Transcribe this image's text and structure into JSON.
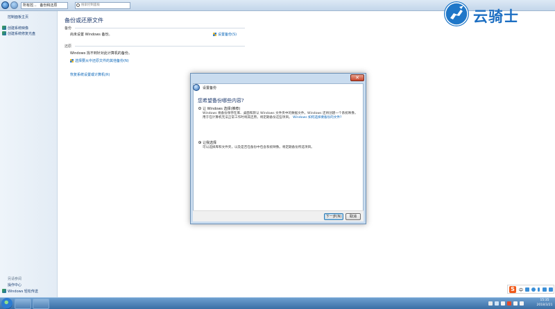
{
  "addressbar": {
    "crumbs": [
      "所有控...",
      "备份和还原"
    ],
    "search_placeholder": "搜索控制面板"
  },
  "leftpane": {
    "home": "控制面板主页",
    "links": [
      "创建系统映像",
      "创建系统修复光盘"
    ],
    "see_also": "另请参阅",
    "action_center": "操作中心",
    "easy_transfer": "Windows 轻松传送"
  },
  "main": {
    "title": "备份或还原文件",
    "backup_label": "备份",
    "backup_status": "尚未设置 Windows 备份。",
    "setup_backup_link": "设置备份(S)",
    "restore_label": "还原",
    "restore_status": "Windows 找不到针对此计算机的备份。",
    "select_backup_link": "选择要从中还原文件的其他备份(N)",
    "recover_link": "恢复系统设置或计算机(R)"
  },
  "dialog": {
    "window_title": "设置备份",
    "close_glyph": "✕",
    "heading": "您希望备份哪些内容?",
    "option1_title": "让 Windows 选择(推荐)",
    "option1_desc": "Windows 将备份保存在库、桌面和默认 Windows 文件夹中的数据文件。Windows 还将创建一个系统映像，用于在计算机无法正常工作时将其还原。将定期备份这些项目。",
    "option1_link": "Windows 如何选择要备份的文件?",
    "option2_title": "让我选择",
    "option2_desc": "可以选择库和文件夹，以及是否在备份中包含系统映像。将定期备份所选项目。",
    "next_button": "下一步(N)",
    "cancel_button": "取消"
  },
  "watermark": {
    "text": "云骑士"
  },
  "taskbar": {
    "clock_time": "15:35",
    "clock_date": "2018/3/21",
    "ime_letter": "S",
    "ime_mode": "中"
  },
  "colors": {
    "accent": "#1d6fc2",
    "link": "#0a66b8",
    "heading": "#1e3a6e",
    "taskbar": "#3a6ea5"
  },
  "icons": {
    "back": "back-arrow-icon",
    "shield": "uac-shield-icon",
    "search": "search-icon",
    "start": "windows-start-icon"
  }
}
